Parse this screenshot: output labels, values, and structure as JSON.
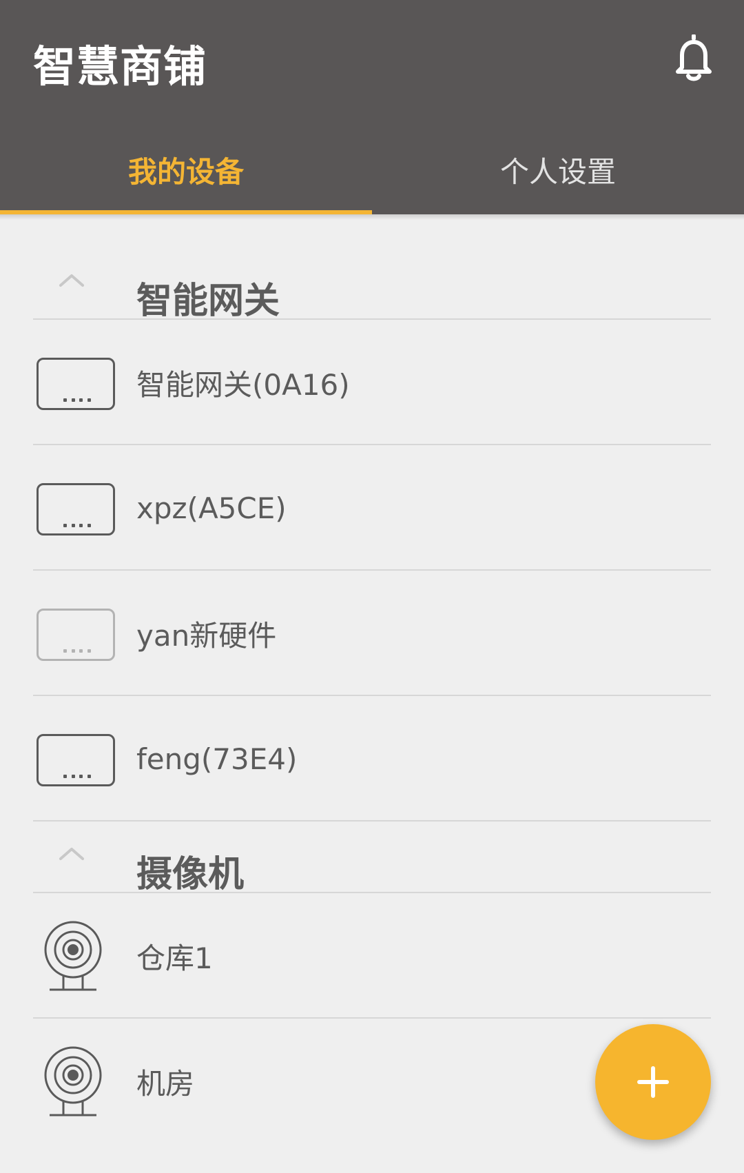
{
  "app": {
    "title": "智慧商铺",
    "notification_icon": "bell-icon"
  },
  "tabs": [
    {
      "label": "我的设备",
      "active": true
    },
    {
      "label": "个人设置",
      "active": false
    }
  ],
  "colors": {
    "appbar": "#595656",
    "accent": "#f4b534",
    "background": "#efefef",
    "text": "#5b5b5b"
  },
  "sections": [
    {
      "title": "智能网关",
      "expand_icon": "chevron-up-icon",
      "items": [
        {
          "label": "智能网关(0A16)",
          "icon": "gateway-icon",
          "online": true
        },
        {
          "label": "xpz(A5CE)",
          "icon": "gateway-icon",
          "online": true
        },
        {
          "label": "yan新硬件",
          "icon": "gateway-icon",
          "online": false
        },
        {
          "label": "feng(73E4)",
          "icon": "gateway-icon",
          "online": true
        }
      ]
    },
    {
      "title": "摄像机",
      "expand_icon": "chevron-up-icon",
      "items": [
        {
          "label": "仓库1",
          "icon": "camera-icon"
        },
        {
          "label": "机房",
          "icon": "camera-icon"
        }
      ]
    }
  ],
  "fab": {
    "icon": "plus-icon"
  }
}
